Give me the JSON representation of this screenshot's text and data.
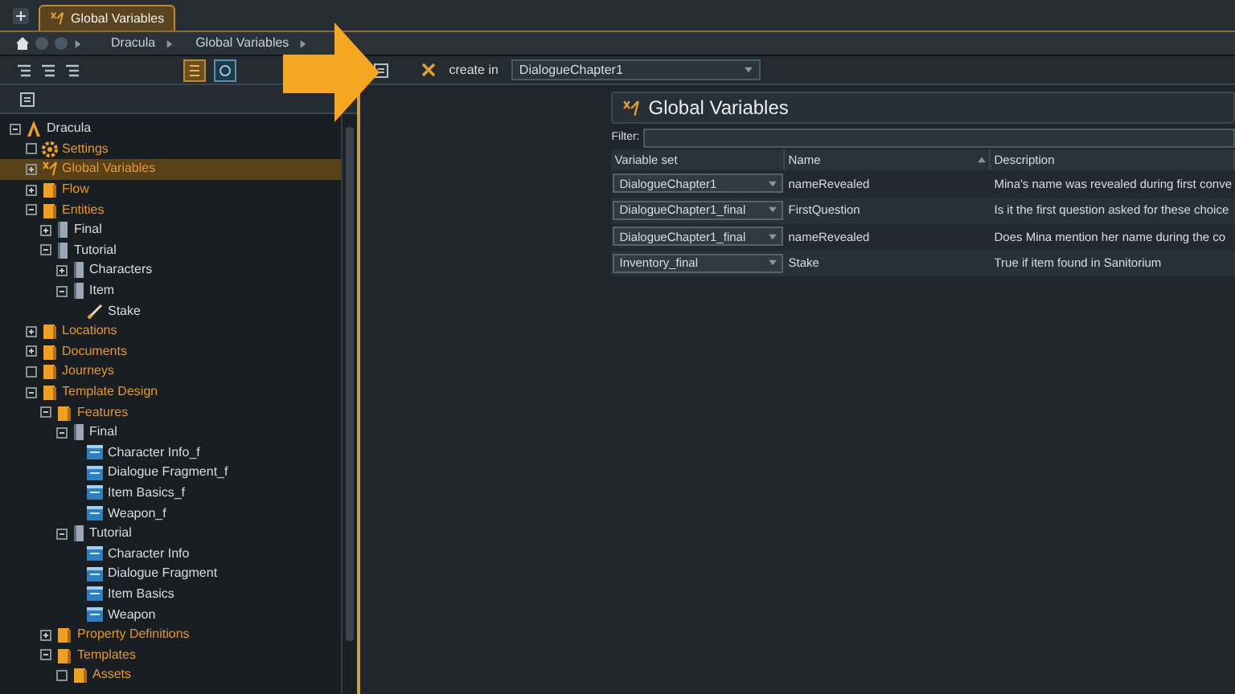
{
  "tab": {
    "label": "Global Variables",
    "selected": true
  },
  "breadcrumb": [
    "Dracula",
    "Global Variables"
  ],
  "tree": [
    {
      "label": "Dracula",
      "kind": "logo",
      "expandable": true,
      "expanded": true,
      "selected": false,
      "children": [
        {
          "label": "Settings",
          "kind": "gear",
          "expandable": false,
          "selected": false
        },
        {
          "label": "Global Variables",
          "kind": "variables",
          "expandable": true,
          "expanded": false,
          "selected": true
        },
        {
          "label": "Flow",
          "kind": "folder",
          "expandable": true,
          "expanded": false,
          "selected": false
        },
        {
          "label": "Entities",
          "kind": "folder",
          "expandable": true,
          "expanded": true,
          "selected": false,
          "children": [
            {
              "label": "Final",
              "kind": "book",
              "expandable": true,
              "expanded": false,
              "selected": false
            },
            {
              "label": "Tutorial",
              "kind": "book",
              "expandable": true,
              "expanded": true,
              "selected": false,
              "children": [
                {
                  "label": "Characters",
                  "kind": "book",
                  "expandable": true,
                  "expanded": false,
                  "selected": false
                },
                {
                  "label": "Item",
                  "kind": "book",
                  "expandable": true,
                  "expanded": true,
                  "selected": false,
                  "children": [
                    {
                      "label": "Stake",
                      "kind": "sword",
                      "selected": false
                    }
                  ]
                }
              ]
            }
          ]
        },
        {
          "label": "Locations",
          "kind": "folder",
          "expandable": true,
          "expanded": false,
          "selected": false
        },
        {
          "label": "Documents",
          "kind": "folder",
          "expandable": true,
          "expanded": false,
          "selected": false
        },
        {
          "label": "Journeys",
          "kind": "folder",
          "expandable": false,
          "selected": false
        },
        {
          "label": "Template Design",
          "kind": "folder",
          "expandable": true,
          "expanded": true,
          "selected": false,
          "children": [
            {
              "label": "Features",
              "kind": "folder",
              "expandable": true,
              "expanded": true,
              "selected": false,
              "children": [
                {
                  "label": "Final",
                  "kind": "book",
                  "expandable": true,
                  "expanded": true,
                  "selected": false,
                  "children": [
                    {
                      "label": "Character Info_f",
                      "kind": "template",
                      "selected": false
                    },
                    {
                      "label": "Dialogue Fragment_f",
                      "kind": "template",
                      "selected": false
                    },
                    {
                      "label": "Item Basics_f",
                      "kind": "template",
                      "selected": false
                    },
                    {
                      "label": "Weapon_f",
                      "kind": "template",
                      "selected": false
                    }
                  ]
                },
                {
                  "label": "Tutorial",
                  "kind": "book",
                  "expandable": true,
                  "expanded": true,
                  "selected": false,
                  "children": [
                    {
                      "label": "Character Info",
                      "kind": "template",
                      "selected": false
                    },
                    {
                      "label": "Dialogue Fragment",
                      "kind": "template",
                      "selected": false
                    },
                    {
                      "label": "Item Basics",
                      "kind": "template",
                      "selected": false
                    },
                    {
                      "label": "Weapon",
                      "kind": "template",
                      "selected": false
                    }
                  ]
                }
              ]
            },
            {
              "label": "Property Definitions",
              "kind": "folder",
              "expandable": true,
              "expanded": false,
              "selected": false
            },
            {
              "label": "Templates",
              "kind": "folder",
              "expandable": true,
              "expanded": true,
              "selected": false,
              "children": [
                {
                  "label": "Assets",
                  "kind": "folder",
                  "expandable": false,
                  "selected": false
                }
              ]
            }
          ]
        }
      ]
    }
  ],
  "create_in": {
    "label": "create in",
    "value": "DialogueChapter1"
  },
  "panel": {
    "title": "Global Variables",
    "filter_label": "Filter:",
    "columns": [
      "Variable set",
      "Name",
      "Description"
    ],
    "rows": [
      {
        "set": "DialogueChapter1",
        "name": "nameRevealed",
        "description": "Mina's name was revealed during first conve"
      },
      {
        "set": "DialogueChapter1_final",
        "name": "FirstQuestion",
        "description": "Is it the first question asked for these choice"
      },
      {
        "set": "DialogueChapter1_final",
        "name": "nameRevealed",
        "description": "Does Mina mention her name during the co"
      },
      {
        "set": "Inventory_final",
        "name": "Stake",
        "description": "True if item found in Sanitorium"
      }
    ]
  }
}
